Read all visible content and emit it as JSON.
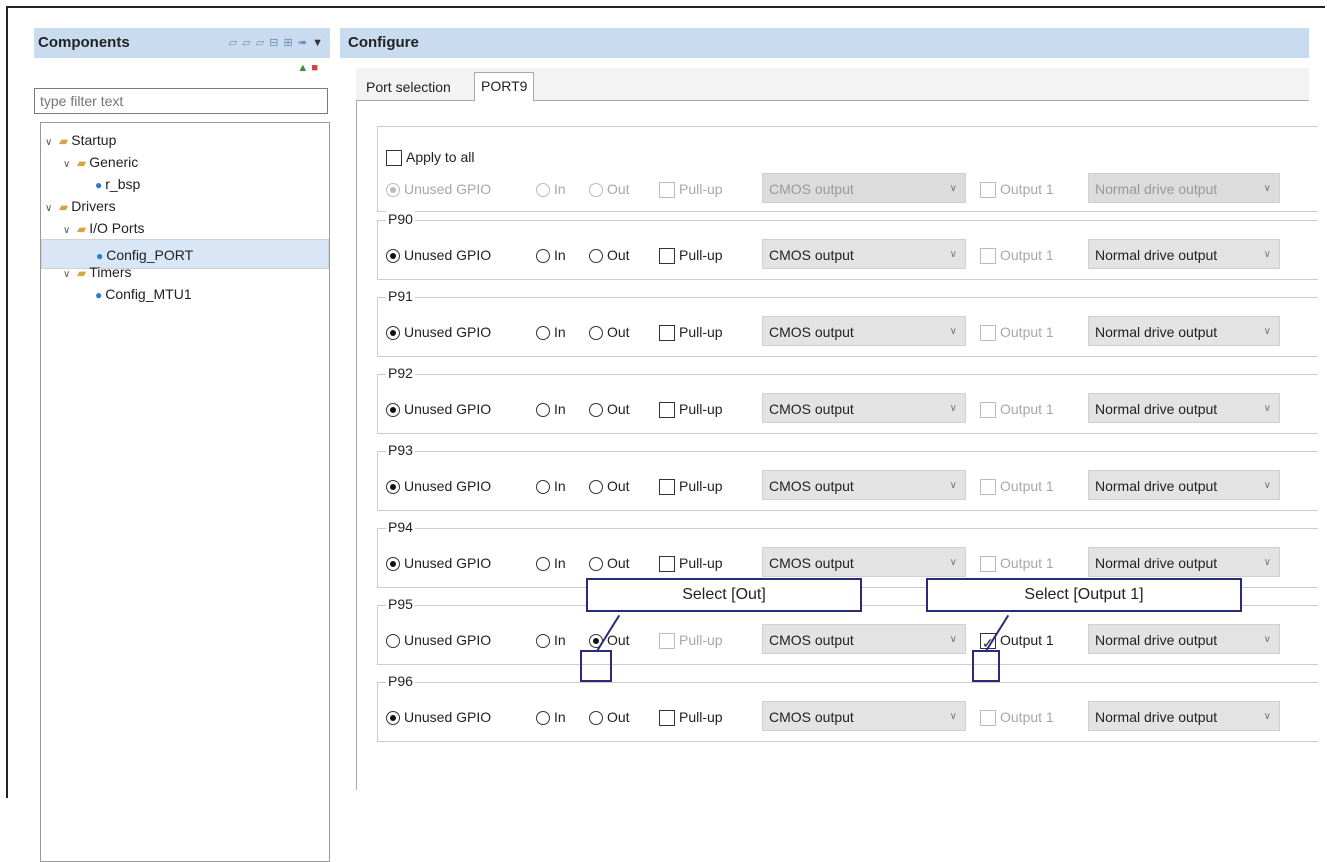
{
  "components_header": {
    "title": "Components"
  },
  "configure_header": {
    "title": "Configure"
  },
  "filter": {
    "placeholder": "type filter text"
  },
  "tree": [
    {
      "label": "Startup",
      "type": "folder",
      "level": 0
    },
    {
      "label": "Generic",
      "type": "folder",
      "level": 1
    },
    {
      "label": "r_bsp",
      "type": "component",
      "level": 2
    },
    {
      "label": "Drivers",
      "type": "folder",
      "level": 0
    },
    {
      "label": "I/O Ports",
      "type": "folder",
      "level": 1
    },
    {
      "label": "Config_PORT",
      "type": "component",
      "level": 2,
      "selected": true
    },
    {
      "label": "Timers",
      "type": "folder",
      "level": 1
    },
    {
      "label": "Config_MTU1",
      "type": "component",
      "level": 2
    }
  ],
  "tabs": [
    {
      "label": "Port selection",
      "active": false
    },
    {
      "label": "PORT9",
      "active": true
    }
  ],
  "apply_all": {
    "label": "Apply to all",
    "checked": false
  },
  "labels": {
    "unused": "Unused GPIO",
    "in": "In",
    "out": "Out",
    "pullup": "Pull-up",
    "cmos": "CMOS output",
    "output1": "Output 1",
    "drive": "Normal drive output"
  },
  "ports": [
    {
      "name": "P90",
      "mode": "unused",
      "pullup": false,
      "output1": false
    },
    {
      "name": "P91",
      "mode": "unused",
      "pullup": false,
      "output1": false
    },
    {
      "name": "P92",
      "mode": "unused",
      "pullup": false,
      "output1": false
    },
    {
      "name": "P93",
      "mode": "unused",
      "pullup": false,
      "output1": false
    },
    {
      "name": "P94",
      "mode": "unused",
      "pullup": false,
      "output1": false
    },
    {
      "name": "P95",
      "mode": "out",
      "pullup": false,
      "output1": true
    },
    {
      "name": "P96",
      "mode": "unused",
      "pullup": false,
      "output1": false
    }
  ],
  "callouts": {
    "out": "Select [Out]",
    "output1": "Select [Output 1]"
  },
  "colors": {
    "header_bg": "#c9dcef",
    "callout_border": "#2b2b7a",
    "selection_bg": "#d8e6f5"
  }
}
